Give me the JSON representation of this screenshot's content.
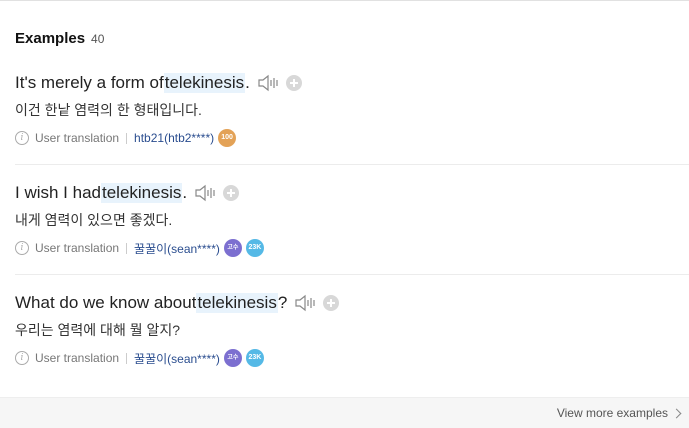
{
  "header": {
    "title": "Examples",
    "count": "40"
  },
  "examples": [
    {
      "pre": "It's merely a form of ",
      "highlight": "telekinesis",
      "post": ".",
      "translation": "이건 한낱 염력의 한 형태입니다.",
      "source_label": "User translation",
      "user": "htb21(htb2****)",
      "badges": [
        "100"
      ]
    },
    {
      "pre": "I wish I had ",
      "highlight": "telekinesis",
      "post": ".",
      "translation": "내게 염력이 있으면 좋겠다.",
      "source_label": "User translation",
      "user": "꿀꿀이(sean****)",
      "badges": [
        "고수",
        "23K"
      ]
    },
    {
      "pre": "What do we know about ",
      "highlight": "telekinesis",
      "post": "?",
      "translation": "우리는 염력에 대해 뭘 알지?",
      "source_label": "User translation",
      "user": "꿀꿀이(sean****)",
      "badges": [
        "고수",
        "23K"
      ]
    }
  ],
  "footer": {
    "more_label": "View more examples"
  },
  "icons": {
    "speaker": "speaker-icon",
    "add": "plus-icon",
    "info": "info-icon",
    "chevron": "chevron-right-icon"
  },
  "colors": {
    "highlight_bg": "#e8f3fc",
    "user_link": "#2a4d8f"
  }
}
